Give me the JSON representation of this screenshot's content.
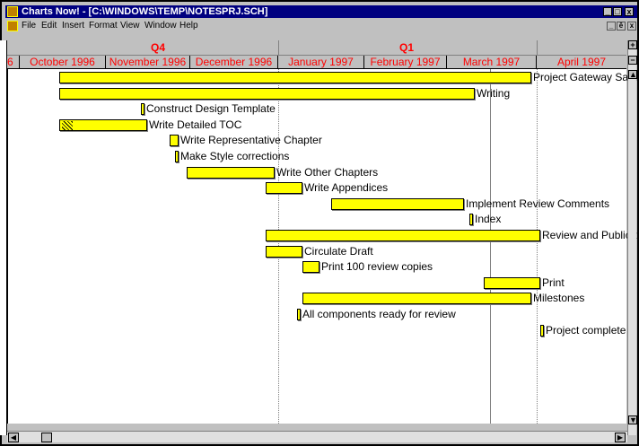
{
  "window": {
    "title": "Charts Now! - [C:\\WINDOWS\\TEMP\\NOTESPRJ.SCH]",
    "caption_buttons": [
      "_",
      "□",
      "x"
    ]
  },
  "menu": {
    "items": [
      "File",
      "Edit",
      "Insert",
      "Format",
      "View",
      "Window",
      "Help"
    ],
    "mdi_buttons": [
      "_",
      "ē",
      "x"
    ]
  },
  "timeline": {
    "quarters": [
      "Q4",
      "Q1"
    ],
    "months": [
      "October 1996",
      "November 1996",
      "December 1996",
      "January 1997",
      "February 1997",
      "March 1997",
      "April 1997"
    ],
    "left_edge_fragment": "6"
  },
  "tasks": [
    {
      "label": "Project Gateway Sample",
      "start": "1996-10-15",
      "end": "1997-03-31",
      "style": "bar"
    },
    {
      "label": "Writing",
      "start": "1996-10-15",
      "end": "1997-03-11",
      "style": "bar"
    },
    {
      "label": "Construct Design Template",
      "start": "1996-11-13",
      "end": "1996-11-14",
      "style": "milestone"
    },
    {
      "label": "Write Detailed TOC",
      "start": "1996-10-15",
      "end": "1996-11-15",
      "style": "hatched"
    },
    {
      "label": "Write Representative Chapter",
      "start": "1996-11-23",
      "end": "1996-11-26",
      "style": "thin"
    },
    {
      "label": "Make Style corrections",
      "start": "1996-11-25",
      "end": "1996-11-26",
      "style": "milestone"
    },
    {
      "label": "Write Other Chapters",
      "start": "1996-11-29",
      "end": "1996-12-30",
      "style": "bar"
    },
    {
      "label": "Write Appendices",
      "start": "1996-12-27",
      "end": "1997-01-09",
      "style": "bar"
    },
    {
      "label": "Implement Review Comments",
      "start": "1997-01-19",
      "end": "1997-03-07",
      "style": "bar"
    },
    {
      "label": "Index",
      "start": "1997-03-09",
      "end": "1997-03-10",
      "style": "milestone"
    },
    {
      "label": "Review and Publication",
      "start": "1996-12-27",
      "end": "1997-04-03",
      "style": "bar"
    },
    {
      "label": "Circulate Draft",
      "start": "1996-12-27",
      "end": "1997-01-09",
      "style": "bar"
    },
    {
      "label": "Print 100 review copies",
      "start": "1997-01-09",
      "end": "1997-01-15",
      "style": "thin"
    },
    {
      "label": "Print",
      "start": "1997-03-14",
      "end": "1997-04-03",
      "style": "bar"
    },
    {
      "label": "Milestones",
      "start": "1997-01-09",
      "end": "1997-03-31",
      "style": "bar"
    },
    {
      "label": "All components ready for review",
      "start": "1997-01-07",
      "end": "1997-01-08",
      "style": "milestone"
    },
    {
      "label": "Project complete",
      "start": "1997-04-03",
      "end": "1997-04-04",
      "style": "milestone"
    }
  ]
}
